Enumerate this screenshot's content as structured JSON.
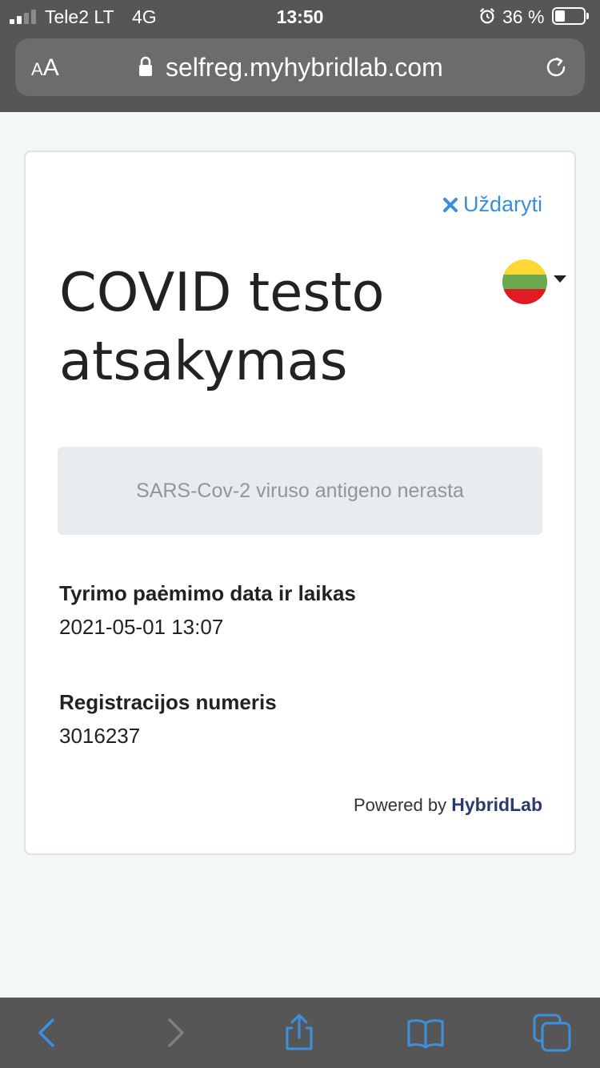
{
  "status_bar": {
    "carrier": "Tele2 LT",
    "network": "4G",
    "time": "13:50",
    "battery": "36 %"
  },
  "browser": {
    "text_size_small": "A",
    "text_size_large": "A",
    "url": "selfreg.myhybridlab.com"
  },
  "card": {
    "close_label": "Uždaryti",
    "title": "COVID testo atsakymas",
    "result": "SARS-Cov-2 viruso antigeno nerasta",
    "date_label": "Tyrimo paėmimo data ir laikas",
    "date_value": "2021-05-01 13:07",
    "reg_label": "Registracijos numeris",
    "reg_value": "3016237",
    "powered_prefix": "Powered by",
    "powered_brand": "HybridLab"
  },
  "flag_colors": [
    "#fdb913",
    "#006a44",
    "#c1272d"
  ],
  "colors": {
    "accent": "#3a8fd8",
    "toolbar_icon": "#3d8fe0",
    "toolbar_icon_disabled": "#808080",
    "chrome": "#565656"
  },
  "icons": {
    "close": "close-icon",
    "language": "language-flag-icon",
    "lock": "lock-icon",
    "reload": "reload-icon",
    "back": "back-chevron-icon",
    "forward": "forward-chevron-icon",
    "share": "share-icon",
    "bookmarks": "bookmarks-icon",
    "tabs": "tabs-icon"
  }
}
